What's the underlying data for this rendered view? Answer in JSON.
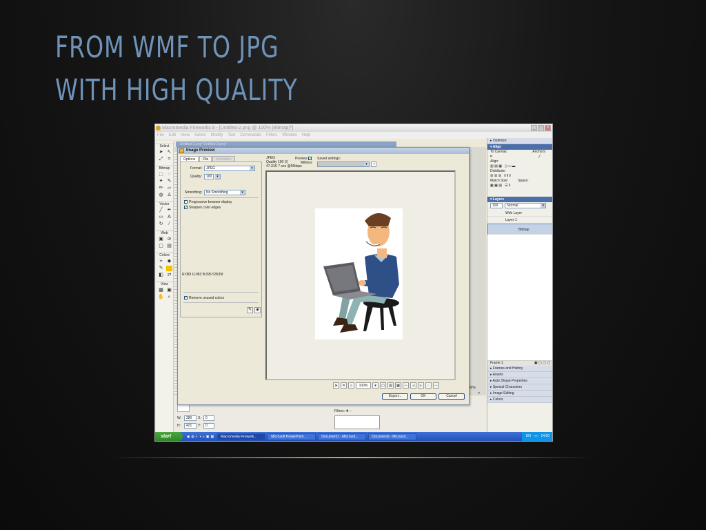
{
  "slide": {
    "title_line1": "FROM WMF TO JPG",
    "title_line2": "WITH HIGH QUALITY"
  },
  "app": {
    "window_title": "Macromedia Fireworks 8 - [Untitled-2.png @ 100% (Bitmap)*]",
    "menu": [
      "File",
      "Edit",
      "View",
      "Select",
      "Modify",
      "Text",
      "Commands",
      "Filters",
      "Window",
      "Help"
    ],
    "doc_tabs": "Untitled-1.png*   Untitled-2.png*"
  },
  "tools": {
    "sections": [
      "Select",
      "Bitmap",
      "Vector",
      "Web",
      "Colors",
      "View"
    ]
  },
  "dialog": {
    "title": "Image Preview",
    "tabs": [
      "Options",
      "File",
      "Animation"
    ],
    "format_label": "Format:",
    "format_value": "JPEG",
    "quality_label": "Quality:",
    "quality_value": "100",
    "smoothing_label": "Smoothing:",
    "smoothing_value": "No Smoothing",
    "progressive_label": "Progressive browser display",
    "sharpen_label": "Sharpen color edges",
    "color_readout": "R:083 G:083 B:095 53535f",
    "remove_unused_label": "Remove unused colors",
    "info_format": "JPEG",
    "info_quality": "Quality 100 (I)",
    "info_size": "47.31K  7 sec @56kbps",
    "preview_label": "Preview",
    "millions_label": "Millions",
    "saved_settings_label": "Saved settings:",
    "zoom_value": "100%",
    "export_button": "Export...",
    "ok_button": "OK",
    "cancel_button": "Cancel"
  },
  "right_panel": {
    "optimize_label": "Optimize",
    "align_label": "Align",
    "to_canvas_label": "To Canvas:",
    "anchors_label": "Anchors:",
    "align_sub": "Align:",
    "distribute_sub": "Distribute:",
    "match_size_sub": "Match Size:",
    "space_sub": "Space:",
    "layers_label": "Layers",
    "opacity_value": "100",
    "blend_value": "Normal",
    "web_layer": "Web Layer",
    "layer1": "Layer 1",
    "bitmap": "Bitmap",
    "frame_label": "Frame 1",
    "collapsed_panels": [
      "Frames and History",
      "Assets",
      "Auto Shape Properties",
      "Special Characters",
      "Image Editing",
      "Colors"
    ]
  },
  "props": {
    "w_label": "W:",
    "w_value": "280",
    "x_label": "X:",
    "x_value": "0",
    "h_label": "H:",
    "h_value": "421",
    "y_label": "Y:",
    "y_value": "0",
    "filters_label": "Filters:",
    "zoom_right": "100%"
  },
  "taskbar": {
    "start_label": "start",
    "items": [
      "Macromedia Firework...",
      "Microsoft PowerPoint ...",
      "Document1 - Microsof...",
      "Document2 - Microsof..."
    ],
    "lang": "EN",
    "clock": "14:50"
  }
}
